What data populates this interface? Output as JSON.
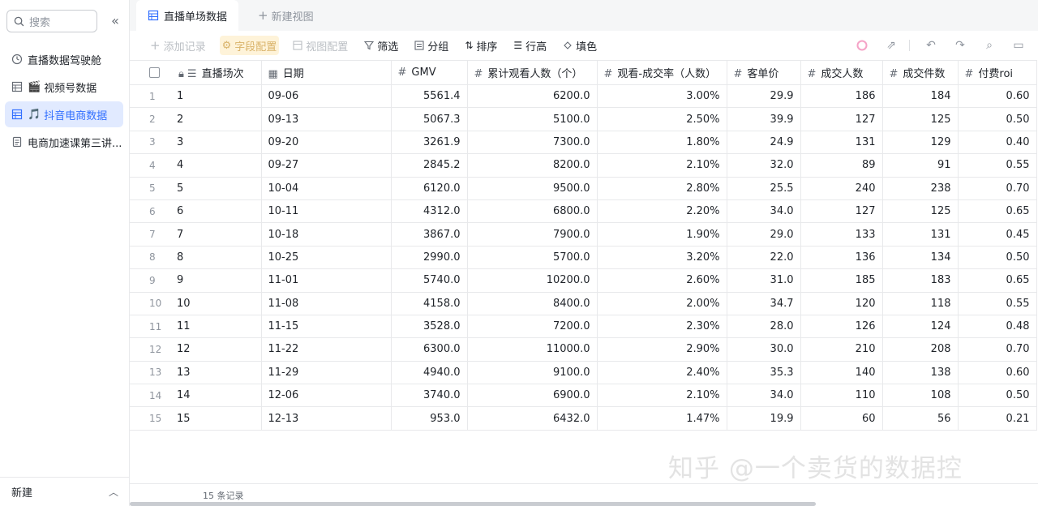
{
  "sidebar": {
    "search_placeholder": "搜索",
    "items": [
      {
        "label": "直播数据驾驶舱",
        "icon": "dashboard-icon",
        "emoji": ""
      },
      {
        "label": "视频号数据",
        "icon": "table-icon",
        "emoji": "🎬"
      },
      {
        "label": "抖音电商数据",
        "icon": "table-icon",
        "emoji": "🎵"
      },
      {
        "label": "电商加速课第三讲...",
        "icon": "doc-icon",
        "emoji": ""
      }
    ],
    "new_label": "新建"
  },
  "tabs": {
    "active_label": "直播单场数据",
    "new_view_label": "新建视图"
  },
  "toolbar": {
    "add_record": "添加记录",
    "field_config": "字段配置",
    "view_config": "视图配置",
    "filter": "筛选",
    "group": "分组",
    "sort": "排序",
    "row_height": "行高",
    "fill_color": "填色"
  },
  "table": {
    "columns": [
      "直播场次",
      "日期",
      "GMV",
      "累计观看人数（个）",
      "观看-成交率（人数）",
      "客单价",
      "成交人数",
      "成交件数",
      "付费roi"
    ],
    "rows": [
      [
        "1",
        "1",
        "09-06",
        "5561.4",
        "6200.0",
        "3.00%",
        "29.9",
        "186",
        "184",
        "0.60"
      ],
      [
        "2",
        "2",
        "09-13",
        "5067.3",
        "5100.0",
        "2.50%",
        "39.9",
        "127",
        "125",
        "0.50"
      ],
      [
        "3",
        "3",
        "09-20",
        "3261.9",
        "7300.0",
        "1.80%",
        "24.9",
        "131",
        "129",
        "0.40"
      ],
      [
        "4",
        "4",
        "09-27",
        "2845.2",
        "8200.0",
        "2.10%",
        "32.0",
        "89",
        "91",
        "0.55"
      ],
      [
        "5",
        "5",
        "10-04",
        "6120.0",
        "9500.0",
        "2.80%",
        "25.5",
        "240",
        "238",
        "0.70"
      ],
      [
        "6",
        "6",
        "10-11",
        "4312.0",
        "6800.0",
        "2.20%",
        "34.0",
        "127",
        "125",
        "0.65"
      ],
      [
        "7",
        "7",
        "10-18",
        "3867.0",
        "7900.0",
        "1.90%",
        "29.0",
        "133",
        "131",
        "0.45"
      ],
      [
        "8",
        "8",
        "10-25",
        "2990.0",
        "5700.0",
        "3.20%",
        "22.0",
        "136",
        "134",
        "0.50"
      ],
      [
        "9",
        "9",
        "11-01",
        "5740.0",
        "10200.0",
        "2.60%",
        "31.0",
        "185",
        "183",
        "0.65"
      ],
      [
        "10",
        "10",
        "11-08",
        "4158.0",
        "8400.0",
        "2.00%",
        "34.7",
        "120",
        "118",
        "0.55"
      ],
      [
        "11",
        "11",
        "11-15",
        "3528.0",
        "7200.0",
        "2.30%",
        "28.0",
        "126",
        "124",
        "0.48"
      ],
      [
        "12",
        "12",
        "11-22",
        "6300.0",
        "11000.0",
        "2.90%",
        "30.0",
        "210",
        "208",
        "0.70"
      ],
      [
        "13",
        "13",
        "11-29",
        "4940.0",
        "9100.0",
        "2.40%",
        "35.3",
        "140",
        "138",
        "0.60"
      ],
      [
        "14",
        "14",
        "12-06",
        "3740.0",
        "6900.0",
        "2.10%",
        "34.0",
        "110",
        "108",
        "0.50"
      ],
      [
        "15",
        "15",
        "12-13",
        "953.0",
        "6432.0",
        "1.47%",
        "19.9",
        "60",
        "56",
        "0.21"
      ]
    ]
  },
  "footer": {
    "record_count": "15 条记录"
  },
  "watermark": "知乎 @一个卖货的数据控",
  "colors": {
    "accent": "#3370ff",
    "active_bg": "#e1eaff",
    "border": "#e8e9eb",
    "highlight_bg": "#fef3d9"
  }
}
